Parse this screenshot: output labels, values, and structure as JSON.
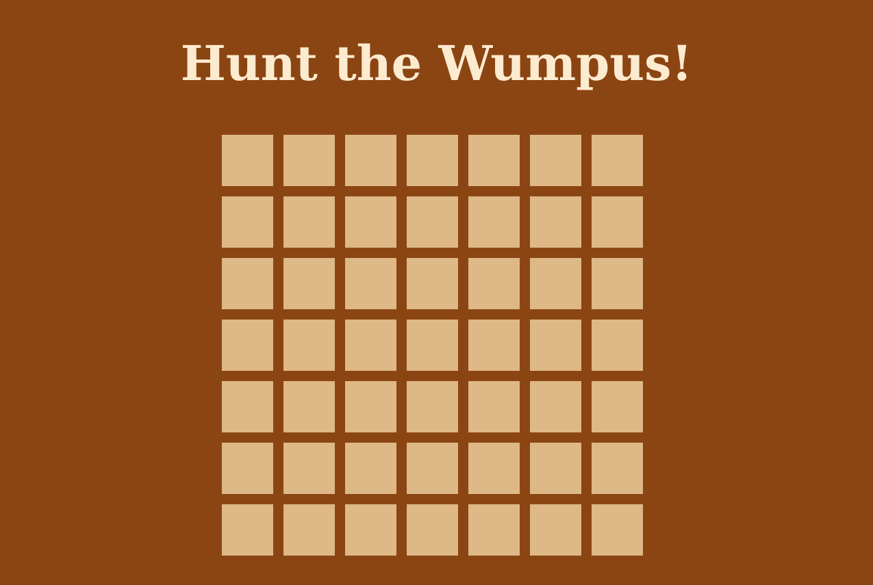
{
  "header": {
    "title": "Hunt the Wumpus!"
  },
  "board": {
    "rows": 7,
    "cols": 7
  },
  "colors": {
    "background": "#8b4513",
    "cell": "#deb887",
    "title": "#fdebd0"
  }
}
